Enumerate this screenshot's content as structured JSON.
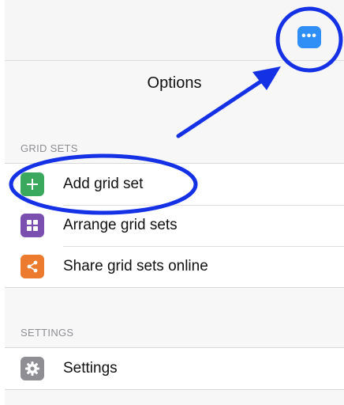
{
  "topbar": {
    "more_icon": "ellipsis-icon",
    "more_glyph": "•••",
    "accent": "#2f8ff7"
  },
  "options": {
    "title": "Options"
  },
  "grid_sets": {
    "header": "GRID SETS",
    "items": [
      {
        "label": "Add grid set",
        "icon": "plus-icon",
        "color": "#3aa85d"
      },
      {
        "label": "Arrange grid sets",
        "icon": "grid-icon",
        "color": "#7b4fb0"
      },
      {
        "label": "Share grid sets online",
        "icon": "share-icon",
        "color": "#ec7a2f"
      }
    ]
  },
  "settings": {
    "header": "SETTINGS",
    "items": [
      {
        "label": "Settings",
        "icon": "gear-icon",
        "color": "#8e8e93"
      }
    ]
  },
  "annotation": {
    "color": "#1431e6"
  }
}
